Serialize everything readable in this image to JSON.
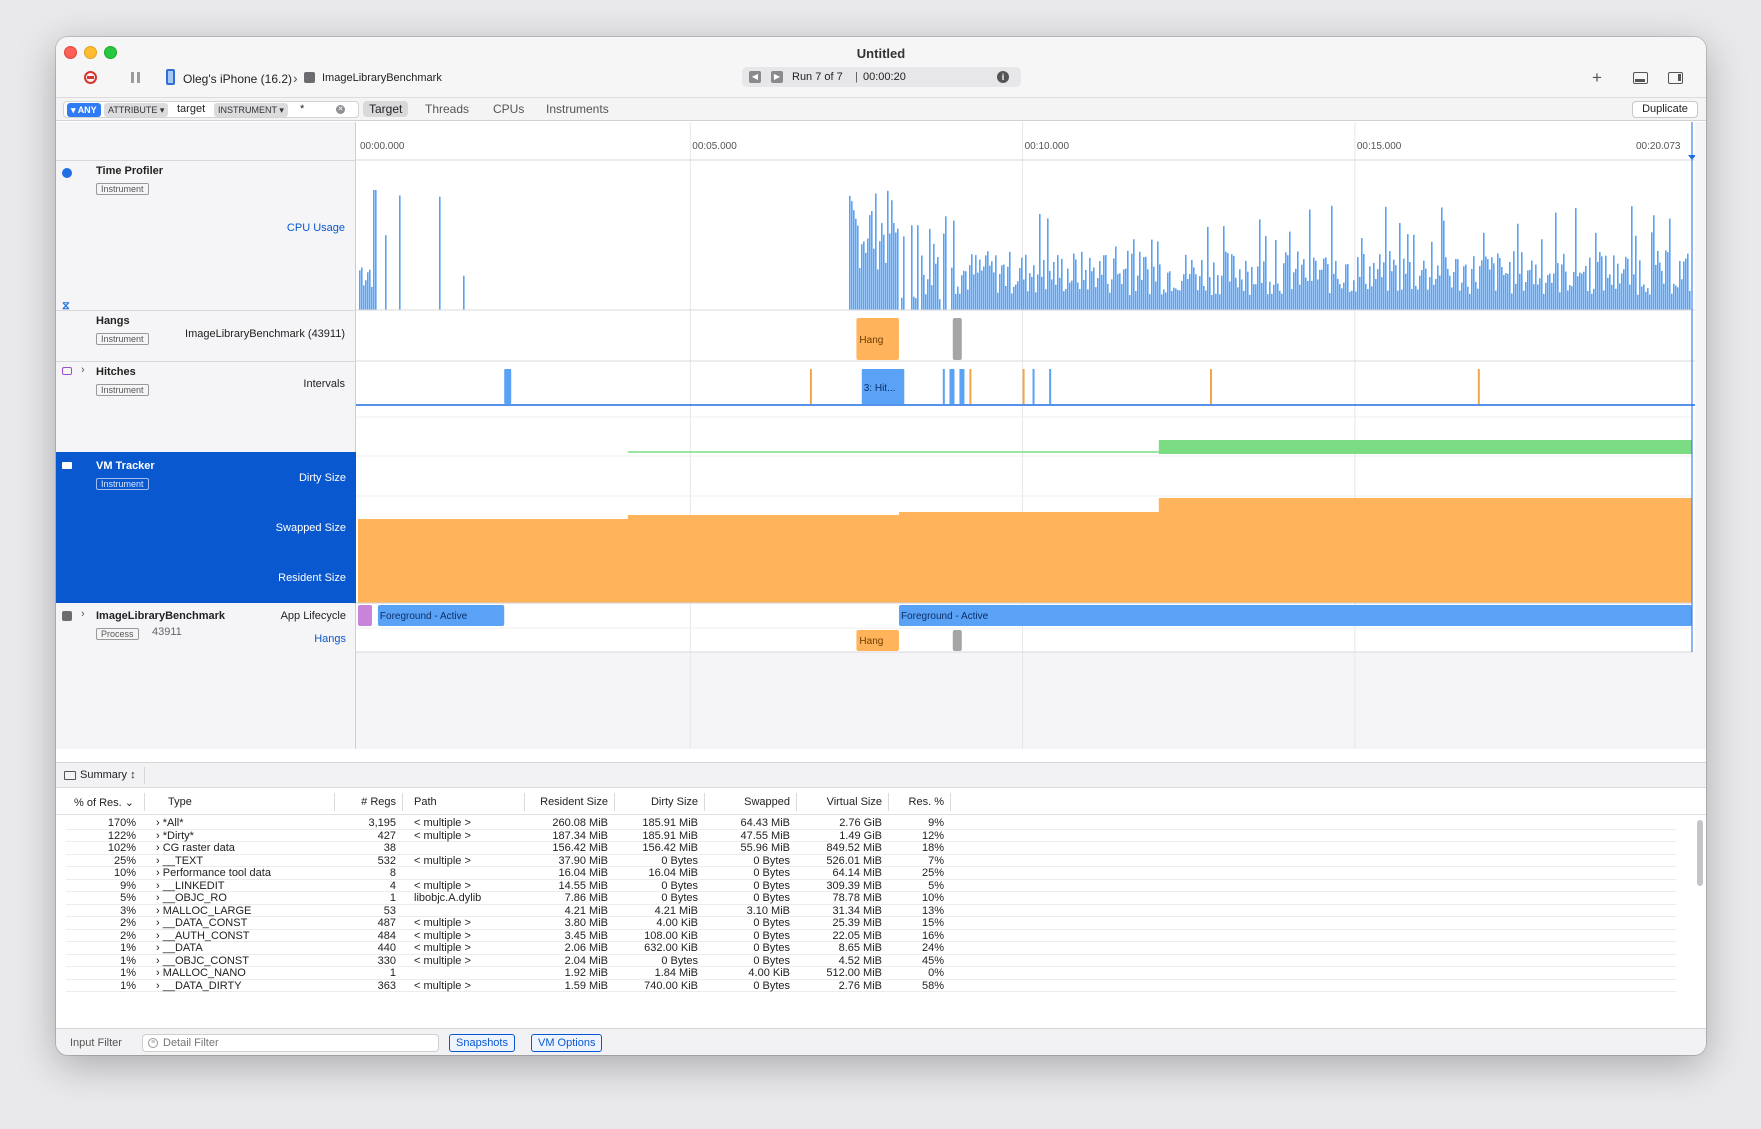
{
  "window": {
    "title": "Untitled",
    "device_label": "Oleg's iPhone (16.2)",
    "target_label": "ImageLibraryBenchmark",
    "run_label": "Run 7 of 7",
    "run_time": "00:00:20",
    "separator": "|"
  },
  "filter": {
    "any_label": "ANY",
    "attribute_label": "ATTRIBUTE",
    "attribute_value": "target",
    "instrument_label": "INSTRUMENT",
    "instrument_value": "*",
    "scopes": [
      "Target",
      "Threads",
      "CPUs",
      "Instruments"
    ],
    "duplicate_label": "Duplicate"
  },
  "timeline": {
    "ticks": [
      "00:00.000",
      "00:05.000",
      "00:10.000",
      "00:15.000",
      "00:20.073"
    ],
    "tick_seconds": [
      0,
      5,
      10,
      15,
      20.073
    ],
    "total_seconds": 20.073
  },
  "tracks": {
    "time_profiler": {
      "name": "Time Profiler",
      "badge": "Instrument",
      "sub": "CPU Usage"
    },
    "hangs": {
      "name": "Hangs",
      "badge": "Instrument",
      "sub": "ImageLibraryBenchmark (43911)",
      "event_label": "Hang"
    },
    "hitches": {
      "name": "Hitches",
      "badge": "Instrument",
      "sub": "Intervals",
      "event_label": "3: Hit..."
    },
    "vm_tracker": {
      "name": "VM Tracker",
      "badge": "Instrument",
      "subs": [
        "Dirty Size",
        "Swapped Size",
        "Resident Size"
      ]
    },
    "process": {
      "name": "ImageLibraryBenchmark",
      "badge": "Process",
      "pid": "43911",
      "sub1": "App Lifecycle",
      "sub2": "Hangs",
      "fg_label": "Foreground - Active",
      "hang_label": "Hang"
    }
  },
  "colors": {
    "accent": "#0a58cf",
    "cpu_bar": "#5aa2f5",
    "hang": "#ffb45c",
    "dirty": "#7bdc84",
    "resident": "#ffb45c",
    "lifecycle": "#5aa2f5",
    "launch": "#c784d8"
  },
  "summary": {
    "mode_label": "Summary",
    "columns": [
      "% of Res.",
      "Type",
      "# Regs",
      "Path",
      "Resident Size",
      "Dirty Size",
      "Swapped",
      "Virtual Size",
      "Res. %"
    ],
    "rows": [
      {
        "pct": "170%",
        "type": "*All*",
        "regs": "3,195",
        "path": "< multiple >",
        "res": "260.08 MiB",
        "dirty": "185.91 MiB",
        "swapped": "64.43 MiB",
        "virtual": "2.76 GiB",
        "respct": "9%"
      },
      {
        "pct": "122%",
        "type": "*Dirty*",
        "regs": "427",
        "path": "< multiple >",
        "res": "187.34 MiB",
        "dirty": "185.91 MiB",
        "swapped": "47.55 MiB",
        "virtual": "1.49 GiB",
        "respct": "12%"
      },
      {
        "pct": "102%",
        "type": "CG raster data",
        "regs": "38",
        "path": "",
        "res": "156.42 MiB",
        "dirty": "156.42 MiB",
        "swapped": "55.96 MiB",
        "virtual": "849.52 MiB",
        "respct": "18%"
      },
      {
        "pct": "25%",
        "type": "__TEXT",
        "regs": "532",
        "path": "< multiple >",
        "res": "37.90 MiB",
        "dirty": "0 Bytes",
        "swapped": "0 Bytes",
        "virtual": "526.01 MiB",
        "respct": "7%"
      },
      {
        "pct": "10%",
        "type": "Performance tool data",
        "regs": "8",
        "path": "",
        "res": "16.04 MiB",
        "dirty": "16.04 MiB",
        "swapped": "0 Bytes",
        "virtual": "64.14 MiB",
        "respct": "25%"
      },
      {
        "pct": "9%",
        "type": "__LINKEDIT",
        "regs": "4",
        "path": "< multiple >",
        "res": "14.55 MiB",
        "dirty": "0 Bytes",
        "swapped": "0 Bytes",
        "virtual": "309.39 MiB",
        "respct": "5%"
      },
      {
        "pct": "5%",
        "type": "__OBJC_RO",
        "regs": "1",
        "path": "libobjc.A.dylib",
        "res": "7.86 MiB",
        "dirty": "0 Bytes",
        "swapped": "0 Bytes",
        "virtual": "78.78 MiB",
        "respct": "10%"
      },
      {
        "pct": "3%",
        "type": "MALLOC_LARGE",
        "regs": "53",
        "path": "",
        "res": "4.21 MiB",
        "dirty": "4.21 MiB",
        "swapped": "3.10 MiB",
        "virtual": "31.34 MiB",
        "respct": "13%"
      },
      {
        "pct": "2%",
        "type": "__DATA_CONST",
        "regs": "487",
        "path": "< multiple >",
        "res": "3.80 MiB",
        "dirty": "4.00 KiB",
        "swapped": "0 Bytes",
        "virtual": "25.39 MiB",
        "respct": "15%"
      },
      {
        "pct": "2%",
        "type": "__AUTH_CONST",
        "regs": "484",
        "path": "< multiple >",
        "res": "3.45 MiB",
        "dirty": "108.00 KiB",
        "swapped": "0 Bytes",
        "virtual": "22.05 MiB",
        "respct": "16%"
      },
      {
        "pct": "1%",
        "type": "__DATA",
        "regs": "440",
        "path": "< multiple >",
        "res": "2.06 MiB",
        "dirty": "632.00 KiB",
        "swapped": "0 Bytes",
        "virtual": "8.65 MiB",
        "respct": "24%"
      },
      {
        "pct": "1%",
        "type": "__OBJC_CONST",
        "regs": "330",
        "path": "< multiple >",
        "res": "2.04 MiB",
        "dirty": "0 Bytes",
        "swapped": "0 Bytes",
        "virtual": "4.52 MiB",
        "respct": "45%"
      },
      {
        "pct": "1%",
        "type": "MALLOC_NANO",
        "regs": "1",
        "path": "",
        "res": "1.92 MiB",
        "dirty": "1.84 MiB",
        "swapped": "4.00 KiB",
        "virtual": "512.00 MiB",
        "respct": "0%"
      },
      {
        "pct": "1%",
        "type": "__DATA_DIRTY",
        "regs": "363",
        "path": "< multiple >",
        "res": "1.59 MiB",
        "dirty": "740.00 KiB",
        "swapped": "0 Bytes",
        "virtual": "2.76 MiB",
        "respct": "58%"
      }
    ]
  },
  "footer": {
    "input_filter_label": "Input Filter",
    "detail_placeholder": "Detail Filter",
    "snapshots_label": "Snapshots",
    "vm_options_label": "VM Options"
  }
}
